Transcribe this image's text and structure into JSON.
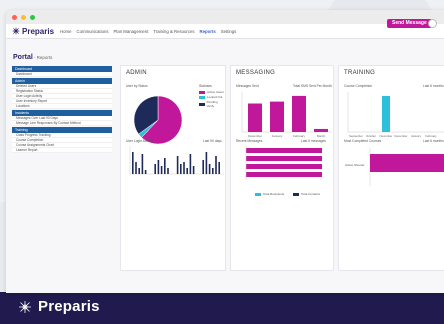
{
  "window": {
    "title": ""
  },
  "brand": {
    "name": "Preparis",
    "icon": "preparis-logo-icon"
  },
  "nav": {
    "links": [
      "Home",
      "Communications",
      "Plan Management",
      "Training & Resources",
      "Reports",
      "Settings"
    ],
    "active_index": 4,
    "send_message_label": "Send Message"
  },
  "page": {
    "title": "Portal",
    "subtitle": "- Reports"
  },
  "sidebar": {
    "sections": [
      {
        "header": "Dashboard",
        "items": [
          "Dashboard"
        ]
      },
      {
        "header": "Admin",
        "items": [
          "Deleted Users",
          "Registration Status",
          "User Login Activity",
          "User Inventory Report",
          "Locations"
        ]
      },
      {
        "header": "Incidents",
        "items": [
          "Messages Over Last 90 Days",
          "Message Line Responses By Contact Method"
        ]
      },
      {
        "header": "Training",
        "items": [
          "Class Progress Tracking",
          "Course Completion",
          "Course Assignments Chart",
          "Learner Report"
        ]
      }
    ]
  },
  "panels": {
    "admin": {
      "title": "ADMIN",
      "users_chart": {
        "label": "User by Status",
        "legend_title": "Statuses",
        "legend": [
          "Active Users",
          "Locked Out",
          "Pending Verify"
        ]
      },
      "login_chart": {
        "label": "User Login Activity",
        "right_label": "Last 90 days"
      }
    },
    "messaging": {
      "title": "MESSAGING",
      "messages_chart": {
        "label": "Messages Sent",
        "right_label": "Total SMS Sent Per Month",
        "categories": [
          "December",
          "January",
          "February",
          "March"
        ]
      },
      "recent_chart": {
        "label": "Recent Messages",
        "right_label": "Last 5 messages",
        "legend": [
          "Total Recipients",
          "Total Contacts"
        ]
      }
    },
    "training": {
      "title": "TRAINING",
      "completion_chart": {
        "label": "Course Completion",
        "right_label": "Last 6 months",
        "categories": [
          "September",
          "October",
          "November",
          "December",
          "January",
          "February"
        ]
      },
      "completed_chart": {
        "label": "Most Completed Courses",
        "right_label": "Last 6 months",
        "row_label": "Active Shooter"
      }
    }
  },
  "colors": {
    "accent": "#c1189b",
    "navy": "#201a4e",
    "cyan": "#2ec0d8",
    "dark_blue": "#1d2a5a",
    "sidebar_head": "#1f5fa0"
  },
  "chart_data": [
    {
      "type": "pie",
      "title": "User by Status",
      "labels": [
        "Active Users",
        "Locked Out",
        "Pending Verify"
      ],
      "values": [
        62,
        3,
        35
      ]
    },
    {
      "type": "bar",
      "title": "Messages Sent",
      "categories": [
        "December",
        "January",
        "February",
        "March"
      ],
      "values": [
        75,
        80,
        95,
        8
      ]
    },
    {
      "type": "bar",
      "title": "Course Completion",
      "categories": [
        "September",
        "October",
        "November",
        "December",
        "January",
        "February"
      ],
      "values": [
        0,
        0,
        100,
        0,
        0,
        0
      ]
    },
    {
      "type": "bar",
      "title": "Most Completed Courses",
      "categories": [
        "Active Shooter"
      ],
      "values": [
        100
      ]
    }
  ]
}
